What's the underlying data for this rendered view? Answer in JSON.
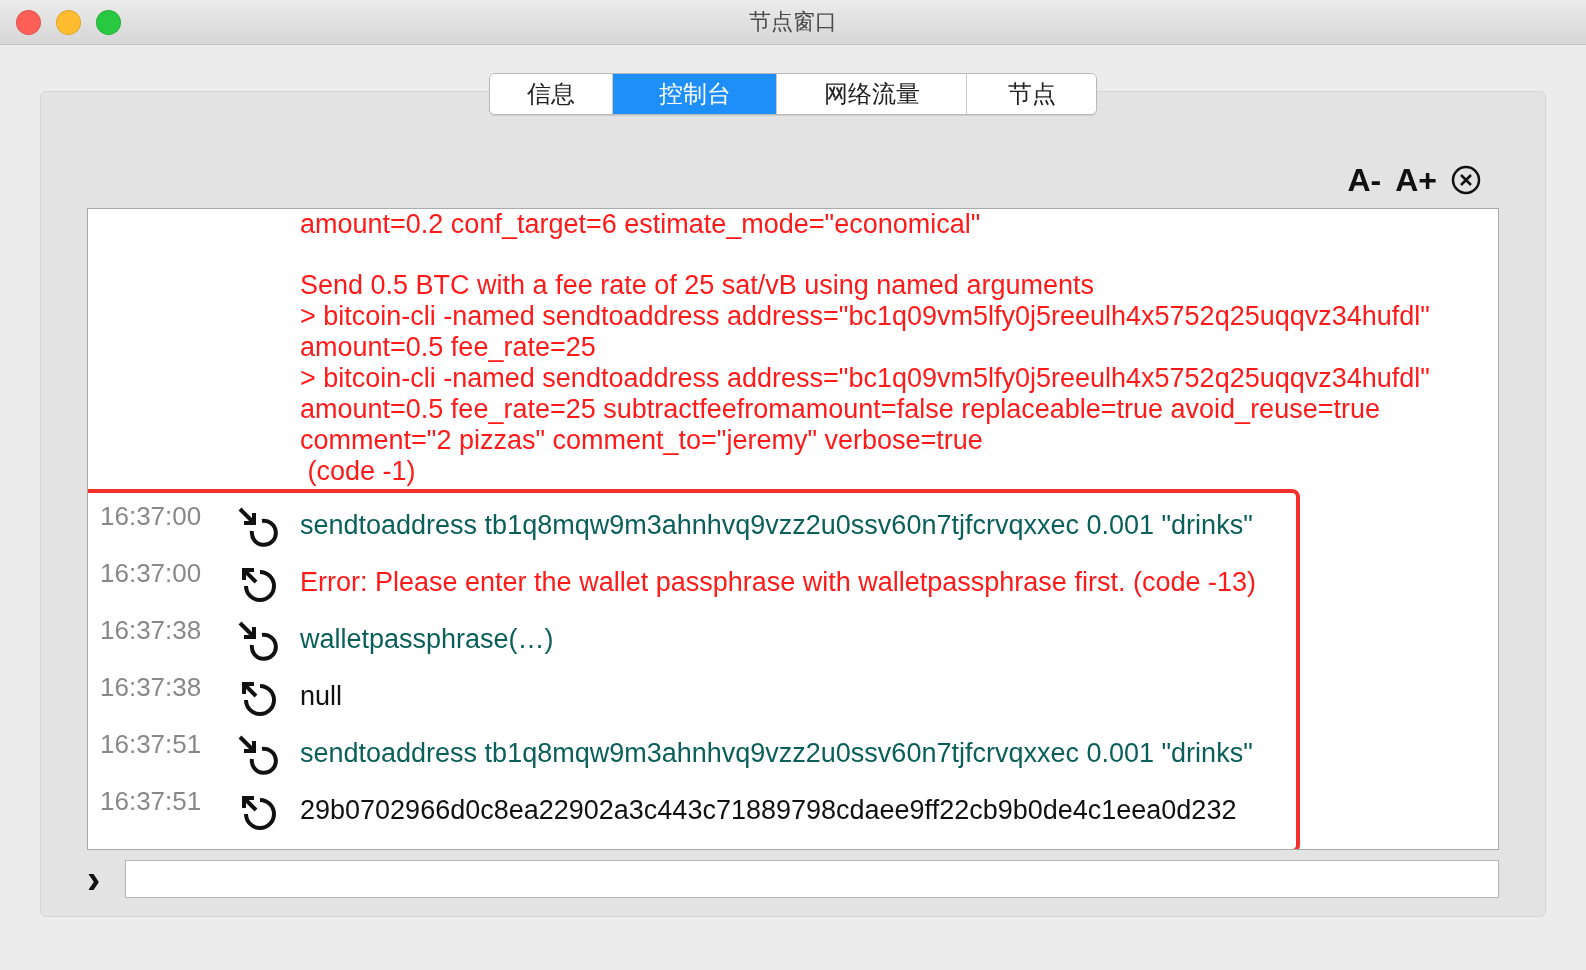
{
  "window": {
    "title": "节点窗口"
  },
  "tabs": [
    {
      "label": "信息",
      "selected": false
    },
    {
      "label": "控制台",
      "selected": true
    },
    {
      "label": "网络流量",
      "selected": false
    },
    {
      "label": "节点",
      "selected": false
    }
  ],
  "font_controls": [
    "A-",
    "A+"
  ],
  "console": {
    "help_blocks": [
      [
        "amount=0.2 conf_target=6 estimate_mode=\"economical\""
      ],
      [
        "Send 0.5 BTC with a fee rate of 25 sat/vB using named arguments",
        "> bitcoin-cli -named sendtoaddress address=\"bc1q09vm5lfy0j5reeulh4x5752q25uqqvz34hufdl\"",
        "amount=0.5 fee_rate=25",
        "> bitcoin-cli -named sendtoaddress address=\"bc1q09vm5lfy0j5reeulh4x5752q25uqqvz34hufdl\"",
        "amount=0.5 fee_rate=25 subtractfeefromamount=false replaceable=true avoid_reuse=true",
        "comment=\"2 pizzas\" comment_to=\"jeremy\" verbose=true",
        " (code -1)"
      ]
    ],
    "entries": [
      {
        "time": "16:37:00",
        "kind": "command",
        "text": "sendtoaddress tb1q8mqw9m3ahnhvq9vzz2u0ssv60n7tjfcrvqxxec 0.001 \"drinks\""
      },
      {
        "time": "16:37:00",
        "kind": "error",
        "text": "Error: Please enter the wallet passphrase with walletpassphrase first. (code -13)"
      },
      {
        "time": "16:37:38",
        "kind": "command",
        "text": "walletpassphrase(…)"
      },
      {
        "time": "16:37:38",
        "kind": "result",
        "text": "null"
      },
      {
        "time": "16:37:51",
        "kind": "command",
        "text": "sendtoaddress tb1q8mqw9m3ahnhvq9vzz2u0ssv60n7tjfcrvqxxec 0.001 \"drinks\""
      },
      {
        "time": "16:37:51",
        "kind": "result",
        "text": "29b0702966d0c8ea22902a3c443c71889798cdaee9ff22cb9b0de4c1eea0d232"
      }
    ],
    "highlighted": true
  },
  "prompt": {
    "symbol": "›"
  }
}
